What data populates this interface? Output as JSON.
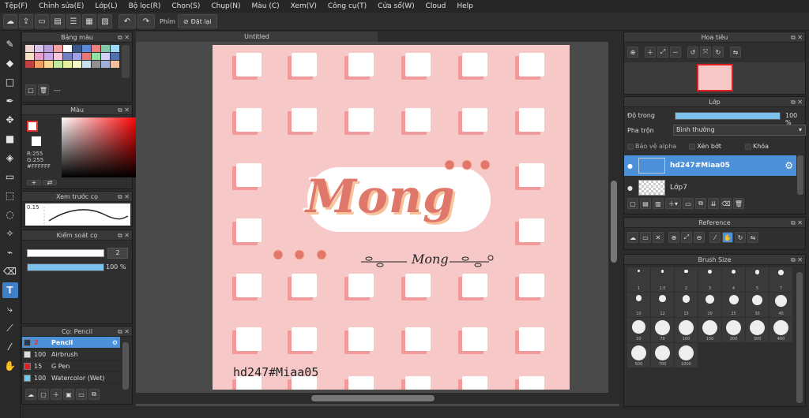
{
  "menu": [
    "Tệp(F)",
    "Chỉnh sửa(E)",
    "Lớp(L)",
    "Bộ lọc(R)",
    "Chọn(S)",
    "Chụp(N)",
    "Màu (C)",
    "Xem(V)",
    "Công cụ(T)",
    "Cửa sổ(W)",
    "Cloud",
    "Help"
  ],
  "toolbar": {
    "stabilizer_label": "Phím",
    "reset_label": "Đặt lại"
  },
  "palette": {
    "title": "Bảng màu",
    "footer": "---",
    "colors": [
      "#f0d4d4",
      "#d8c4e8",
      "#b8a0d8",
      "#f4a0a0",
      "#ffffff",
      "#3a5a8c",
      "#5a8ad8",
      "#f08080",
      "#80c8a8",
      "#a0d8f8",
      "#f8e0c8",
      "#e8a0c8",
      "#c8a8e8",
      "#f8c8d8",
      "#7080c0",
      "#a0a0e8",
      "#e87878",
      "#90e0a0",
      "#d0d0f8",
      "#5070b0",
      "#c04040",
      "#f0a060",
      "#f8d890",
      "#c0e8a0",
      "#e8f0a0",
      "#f8f8c8",
      "#c8e0f0",
      "#909090",
      "#a0b0d8",
      "#f0c0a0"
    ]
  },
  "color": {
    "title": "Màu",
    "r": "R:255",
    "g": "G:255",
    "hex": "#FFFFFF"
  },
  "preview": {
    "title": "Xem trước cọ",
    "value": "0.15"
  },
  "brush_control": {
    "title": "Kiểm soát cọ",
    "size": "2",
    "opacity": "100 %",
    "opacity_fraction": 1.0
  },
  "brush_list": {
    "title": "Cọ: Pencil",
    "items": [
      {
        "size": "2",
        "name": "Pencil",
        "color": "#1e3a5a",
        "selected": true
      },
      {
        "size": "100",
        "name": "Airbrush",
        "color": "#dddddd",
        "selected": false
      },
      {
        "size": "15",
        "name": "G Pen",
        "color": "#e02020",
        "selected": false
      },
      {
        "size": "100",
        "name": "Watercolor (Wet)",
        "color": "#6ec8f0",
        "selected": false
      }
    ]
  },
  "canvas": {
    "tab_title": "Untitled",
    "big_text": "Mong",
    "small_text": "Mong",
    "watermark": "hd247#Miaa05"
  },
  "navigator": {
    "title": "Hoa tiêu"
  },
  "layers": {
    "title": "Lớp",
    "opacity_label": "Độ trong",
    "opacity_value": "100 %",
    "blend_label": "Pha trộn",
    "blend_value": "Bình thường",
    "protect_alpha": "Bảo vệ alpha",
    "clipping": "Xén bớt",
    "lock": "Khóa",
    "items": [
      {
        "name": "hd247#Miaa05",
        "selected": true
      },
      {
        "name": "Lớp7",
        "selected": false
      }
    ]
  },
  "reference": {
    "title": "Reference"
  },
  "brush_size": {
    "title": "Brush Size",
    "sizes": [
      "1",
      "1.5",
      "2",
      "3",
      "4",
      "5",
      "7",
      "10",
      "12",
      "15",
      "20",
      "25",
      "30",
      "40",
      "50",
      "70",
      "100",
      "150",
      "200",
      "300",
      "400",
      "500",
      "700",
      "1000"
    ]
  },
  "accent": "#4b90d8"
}
